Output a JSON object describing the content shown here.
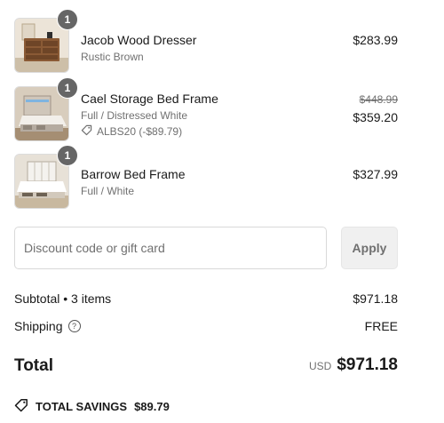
{
  "items": [
    {
      "name": "Jacob Wood Dresser",
      "variant": "Rustic Brown",
      "quantity": "1",
      "price": "$283.99",
      "image": "dresser-image"
    },
    {
      "name": "Cael Storage Bed Frame",
      "variant": "Full / Distressed White",
      "quantity": "1",
      "original_price": "$448.99",
      "price": "$359.20",
      "discount": "ALBS20 (-$89.79)",
      "image": "storage-bed-image"
    },
    {
      "name": "Barrow Bed Frame",
      "variant": "Full / White",
      "quantity": "1",
      "price": "$327.99",
      "image": "bed-frame-image"
    }
  ],
  "discount_field": {
    "placeholder": "Discount code or gift card",
    "value": ""
  },
  "apply_label": "Apply",
  "subtotal": {
    "label": "Subtotal • 3 items",
    "value": "$971.18"
  },
  "shipping": {
    "label": "Shipping",
    "value": "FREE",
    "icon": "help-circle-icon"
  },
  "total": {
    "label": "Total",
    "currency": "USD",
    "value": "$971.18"
  },
  "savings": {
    "label": "TOTAL SAVINGS",
    "value": "$89.79",
    "icon": "tag-icon"
  },
  "colors": {
    "badge": "#666666",
    "muted": "#707070",
    "apply_bg": "#f0f0f0"
  }
}
